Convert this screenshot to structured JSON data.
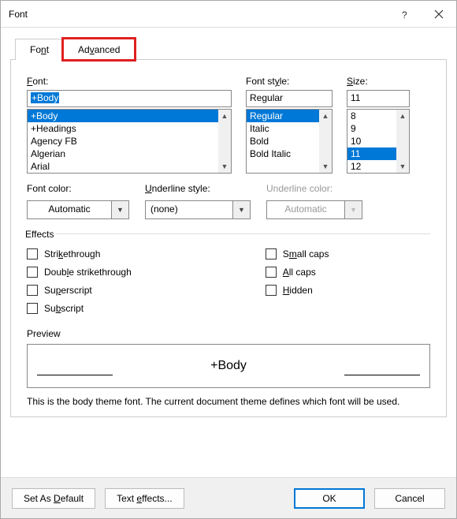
{
  "title": "Font",
  "tabs": {
    "font": "Font",
    "advanced": "Advanced"
  },
  "labels": {
    "font": "Font:",
    "fontstyle": "Font style:",
    "size": "Size:",
    "fontcolor": "Font color:",
    "underlinestyle": "Underline style:",
    "underlinecolor": "Underline color:",
    "effects": "Effects",
    "preview": "Preview"
  },
  "accel": {
    "font": "F",
    "fontstyle": "y",
    "size": "S",
    "advanced": "v",
    "underlinestyle": "U",
    "strikethrough": "k",
    "doublestrike": "l",
    "superscript": "p",
    "subscript": "b",
    "smallcaps": "m",
    "allcaps": "A",
    "hidden": "H",
    "setdefault": "D",
    "texteffects": "e"
  },
  "font": {
    "value": "+Body",
    "list": [
      "+Body",
      "+Headings",
      "Agency FB",
      "Algerian",
      "Arial"
    ],
    "selectedIndex": 0
  },
  "style": {
    "value": "Regular",
    "list": [
      "Regular",
      "Italic",
      "Bold",
      "Bold Italic"
    ],
    "selectedIndex": 0
  },
  "size": {
    "value": "11",
    "list": [
      "8",
      "9",
      "10",
      "11",
      "12"
    ],
    "selectedIndex": 3
  },
  "fontcolor": "Automatic",
  "underlinestyle": "(none)",
  "underlinecolor": "Automatic",
  "effects_list": {
    "strikethrough": "Strikethrough",
    "doublestrike": "Double strikethrough",
    "superscript": "Superscript",
    "subscript": "Subscript",
    "smallcaps": "Small caps",
    "allcaps": "All caps",
    "hidden": "Hidden"
  },
  "preview": {
    "text": "+Body",
    "desc": "This is the body theme font. The current document theme defines which font will be used."
  },
  "buttons": {
    "setdefault": "Set As Default",
    "texteffects": "Text Effects...",
    "ok": "OK",
    "cancel": "Cancel"
  }
}
